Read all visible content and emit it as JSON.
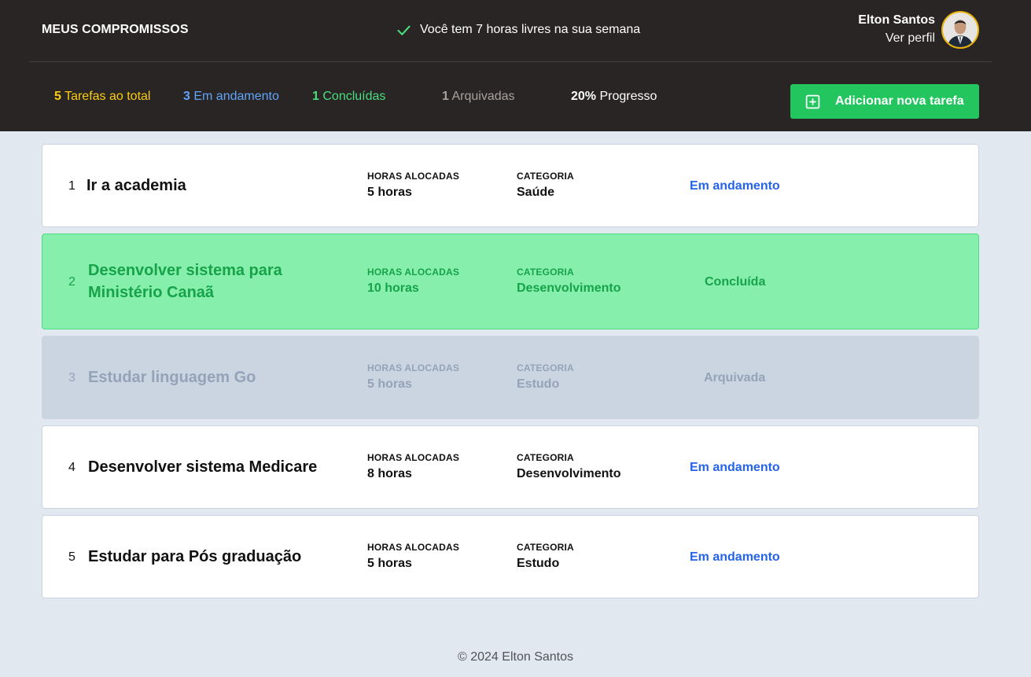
{
  "header": {
    "brand": "MEUS COMPROMISSOS",
    "free_hours": "Você tem 7 horas livres na sua semana",
    "free_hours_icon": "check-icon",
    "user_name": "Elton Santos",
    "profile_link": "Ver perfil"
  },
  "stats": {
    "total_count": "5",
    "total_label": "Tarefas ao total",
    "in_progress_count": "3",
    "in_progress_label": "Em andamento",
    "done_count": "1",
    "done_label": "Concluídas",
    "archived_count": "1",
    "archived_label": "Arquivadas",
    "progress_value": "20%",
    "progress_label": "Progresso",
    "add_button": "Adicionar nova tarefa",
    "add_button_icon": "plus-square-icon"
  },
  "columns": {
    "hours_label": "HORAS ALOCADAS",
    "category_label": "CATEGORIA"
  },
  "tasks": [
    {
      "number": "1",
      "title": "Ir a academia",
      "hours": "5 horas",
      "category": "Saúde",
      "status": "Em andamento"
    },
    {
      "number": "2",
      "title_line1": "Desenvolver sistema para",
      "title_line2": "Ministério Canaã",
      "hours": "10 horas",
      "category": "Desenvolvimento",
      "status": "Concluída"
    },
    {
      "number": "3",
      "title": "Estudar linguagem Go",
      "hours": "5 horas",
      "category": "Estudo",
      "status": "Arquivada"
    },
    {
      "number": "4",
      "title": "Desenvolver sistema Medicare",
      "hours": "8 horas",
      "category": "Desenvolvimento",
      "status": "Em andamento"
    },
    {
      "number": "5",
      "title": "Estudar para Pós graduação",
      "hours": "5 horas",
      "category": "Estudo",
      "status": "Em andamento"
    }
  ],
  "footer": {
    "text": "© 2024 Elton Santos"
  },
  "colors": {
    "header_bg": "#292524",
    "page_bg": "#e2e8f0",
    "total": "#facc15",
    "in_progress": "#60a5fa",
    "done": "#4ade80",
    "archived": "#a8a29e",
    "button": "#22c55e",
    "status_running": "#2563eb",
    "done_row": "#86efac",
    "archived_row": "#cbd5e1"
  }
}
